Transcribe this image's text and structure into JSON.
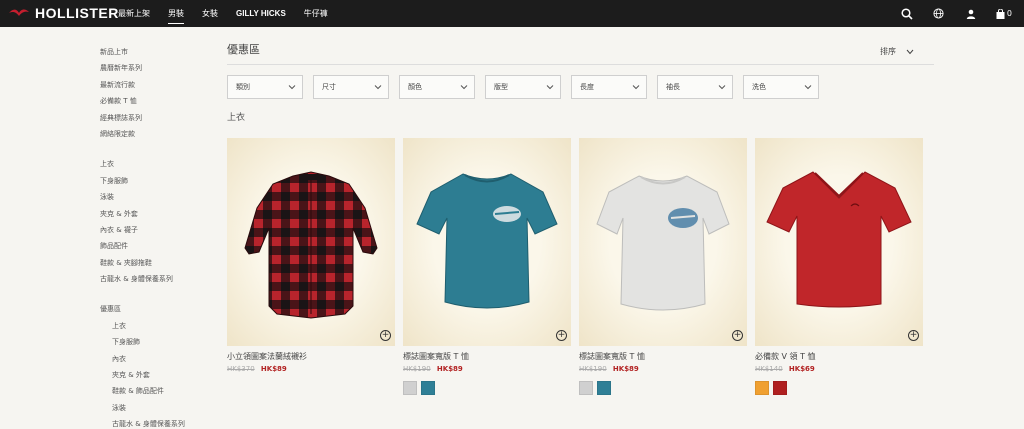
{
  "header": {
    "brand": "HOLLISTER",
    "nav": [
      {
        "label": "最新上架",
        "active": false
      },
      {
        "label": "男裝",
        "active": true
      },
      {
        "label": "女裝",
        "active": false
      },
      {
        "label": "GILLY HICKS",
        "active": false
      },
      {
        "label": "牛仔褲",
        "active": false
      }
    ],
    "bag_count": "0",
    "icons": [
      "search-icon",
      "globe-icon",
      "user-icon",
      "bag-icon"
    ]
  },
  "sidebar": {
    "groups": [
      {
        "items": [
          "新品上市",
          "農曆新年系列",
          "最新流行款",
          "必備款 T 恤",
          "經典標誌系列",
          "網絡限定款"
        ]
      },
      {
        "items": [
          "上衣",
          "下身服飾",
          "泳裝",
          "夾克 & 外套",
          "內衣 & 襪子",
          "飾品配件",
          "鞋款 & 夾腳拖鞋",
          "古龍水 & 身體保養系列"
        ]
      },
      {
        "items": [
          "優惠區"
        ],
        "subitems": [
          "上衣",
          "下身服飾",
          "內衣",
          "夾克 & 外套",
          "鞋款 & 飾品配件",
          "泳裝",
          "古龍水 & 身體保養系列"
        ]
      }
    ]
  },
  "main": {
    "title": "優惠區",
    "sort_label": "排序",
    "filters": [
      "類別",
      "尺寸",
      "顏色",
      "版型",
      "長度",
      "袖長",
      "洗色"
    ],
    "section_title": "上衣",
    "products": [
      {
        "name": "小立領圖案法蘭絨襯衫",
        "old_price": "HK$370",
        "new_price": "HK$89",
        "shirt": "flannel",
        "colors": []
      },
      {
        "name": "標誌圖案寬版 T 恤",
        "old_price": "HK$190",
        "new_price": "HK$89",
        "shirt": "teal-tee",
        "colors": [
          "#d0d0d0",
          "#2f7f96"
        ]
      },
      {
        "name": "標誌圖案寬版 T 恤",
        "old_price": "HK$190",
        "new_price": "HK$89",
        "shirt": "white-tee",
        "colors": [
          "#d0d0d0",
          "#2f7f96"
        ]
      },
      {
        "name": "必備款 V 領 T 恤",
        "old_price": "HK$140",
        "new_price": "HK$69",
        "shirt": "red-vneck",
        "colors": [
          "#f0a030",
          "#b02020"
        ]
      }
    ]
  },
  "colors": {
    "topbar": "#1c1c1c",
    "background": "#f6f5f1",
    "sale_red": "#b22222"
  }
}
